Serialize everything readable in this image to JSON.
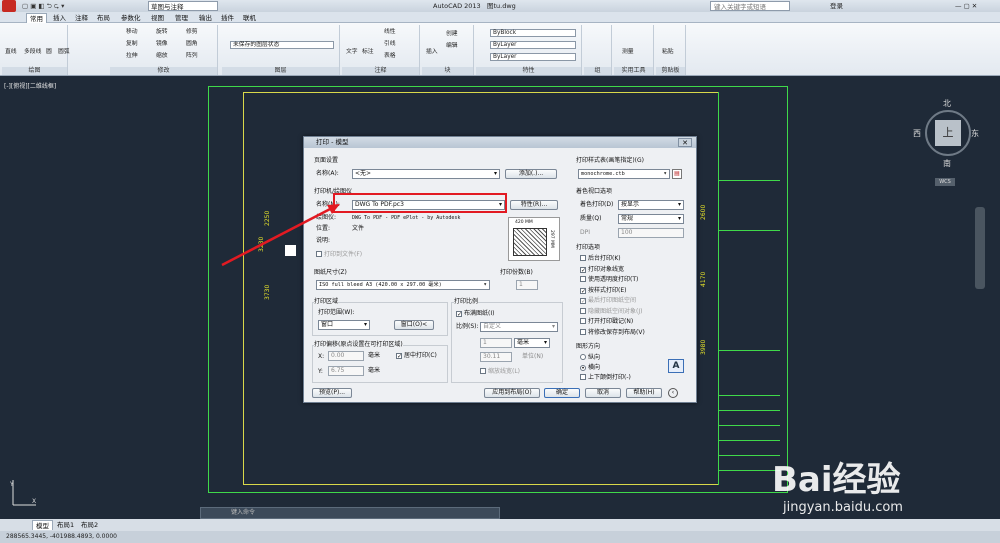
{
  "window": {
    "title": "AutoCAD 2013",
    "filename": "图tu.dwg",
    "workspace": "草图与注释",
    "search_placeholder": "键入关键字或短语",
    "login": "登录"
  },
  "tabs": [
    "常用",
    "插入",
    "注释",
    "布局",
    "参数化",
    "视图",
    "管理",
    "输出",
    "插件",
    "联机"
  ],
  "ribbon": {
    "draw": {
      "title": "绘图",
      "items": [
        "直线",
        "多段线",
        "圆",
        "圆弧"
      ]
    },
    "modify": {
      "title": "修改",
      "items": [
        "移动",
        "旋转",
        "修剪",
        "复制",
        "镜像",
        "圆角",
        "拉伸",
        "缩放",
        "阵列"
      ]
    },
    "layers": {
      "title": "图层",
      "state": "未保存的图层状态"
    },
    "annotation": {
      "title": "注释",
      "items": [
        "文字",
        "标注",
        "线性",
        "引线",
        "表格"
      ]
    },
    "block": {
      "title": "块",
      "items": [
        "插入",
        "创建",
        "编辑"
      ]
    },
    "properties": {
      "title": "特性",
      "bylayer1": "ByBlock",
      "bylayer2": "ByLayer",
      "bylayer3": "ByLayer"
    },
    "groups": {
      "title": "组"
    },
    "utilities": {
      "title": "实用工具",
      "item": "测量"
    },
    "clipboard": {
      "title": "剪贴板",
      "item": "粘贴"
    }
  },
  "viewport_label": "[-][俯视][二维线框]",
  "compass": {
    "north": "北",
    "south": "南",
    "east": "东",
    "west": "西",
    "top": "上",
    "wcs": "WCS"
  },
  "dims": {
    "d1": "2250",
    "d2": "3230",
    "d3": "3730",
    "d4": "2600",
    "d5": "4170",
    "d6": "3980"
  },
  "dialog": {
    "title": "打印 - 模型",
    "page_setup": {
      "heading": "页面设置",
      "name_label": "名称(A):",
      "name_value": "<无>",
      "add_btn": "添加(.)..."
    },
    "printer": {
      "heading": "打印机/绘图仪",
      "name_label": "名称(M):",
      "name_value": "DWG To PDF.pc3",
      "props_btn": "特性(R)...",
      "plotter_label": "绘图仪:",
      "plotter_value": "DWG To PDF - PDF ePlot - by Autodesk",
      "location_label": "位置:",
      "location_value": "文件",
      "desc_label": "说明:",
      "print_to_file": "打印到文件(F)",
      "preview_w": "420 MM",
      "preview_h": "297 MM"
    },
    "paper": {
      "heading": "图纸尺寸(Z)",
      "value": "ISO full bleed A3 (420.00 x 297.00 毫米)"
    },
    "copies": {
      "heading": "打印份数(B)",
      "value": "1"
    },
    "area": {
      "heading": "打印区域",
      "range_label": "打印范围(W):",
      "range_value": "窗口",
      "window_btn": "窗口(O)<"
    },
    "offset": {
      "heading": "打印偏移(原点设置在可打印区域)",
      "x_label": "X:",
      "x_value": "0.00",
      "y_label": "Y:",
      "y_value": "6.75",
      "unit": "毫米",
      "center": "居中打印(C)"
    },
    "scale": {
      "heading": "打印比例",
      "fit": "布满图纸(I)",
      "ratio_label": "比例(S):",
      "ratio_value": "自定义",
      "v1": "1",
      "unit_value": "毫米",
      "v2": "30.11",
      "unit_label": "单位(N)",
      "lineweight": "缩放线宽(L)"
    },
    "style": {
      "heading": "打印样式表(画笔指定)(G)",
      "value": "monochrome.ctb"
    },
    "shaded": {
      "heading": "着色视口选项",
      "shade_label": "着色打印(D)",
      "shade_value": "按显示",
      "quality_label": "质量(Q)",
      "quality_value": "常规",
      "dpi_label": "DPI",
      "dpi_value": "100"
    },
    "options": {
      "heading": "打印选项",
      "items": [
        {
          "text": "后台打印(K)",
          "checked": false,
          "disabled": false
        },
        {
          "text": "打印对象线宽",
          "checked": true,
          "disabled": false
        },
        {
          "text": "使用透明度打印(T)",
          "checked": false,
          "disabled": false
        },
        {
          "text": "按样式打印(E)",
          "checked": true,
          "disabled": false
        },
        {
          "text": "最后打印图纸空间",
          "checked": true,
          "disabled": true
        },
        {
          "text": "隐藏图纸空间对象(J)",
          "checked": false,
          "disabled": true
        },
        {
          "text": "打开打印戳记(N)",
          "checked": false,
          "disabled": false
        },
        {
          "text": "将修改保存到布局(V)",
          "checked": false,
          "disabled": false
        }
      ]
    },
    "orientation": {
      "heading": "图形方向",
      "portrait": "纵向",
      "landscape": "横向",
      "upside": "上下颠倒打印(-)"
    },
    "buttons": {
      "preview": "预览(P)...",
      "apply": "应用到布局(O)",
      "ok": "确定",
      "cancel": "取消",
      "help": "帮助(H)"
    }
  },
  "cmdline": "键入命令",
  "layout_tabs": [
    "模型",
    "布局1",
    "布局2"
  ],
  "status": "288565.3445, -401988.4893, 0.0000",
  "watermark": {
    "brand": "Bai经验",
    "url": "jingyan.baidu.com"
  },
  "colors": {
    "highlight": "#e21a22",
    "frame": "#3fd94a",
    "yellow": "#d8d84a"
  }
}
